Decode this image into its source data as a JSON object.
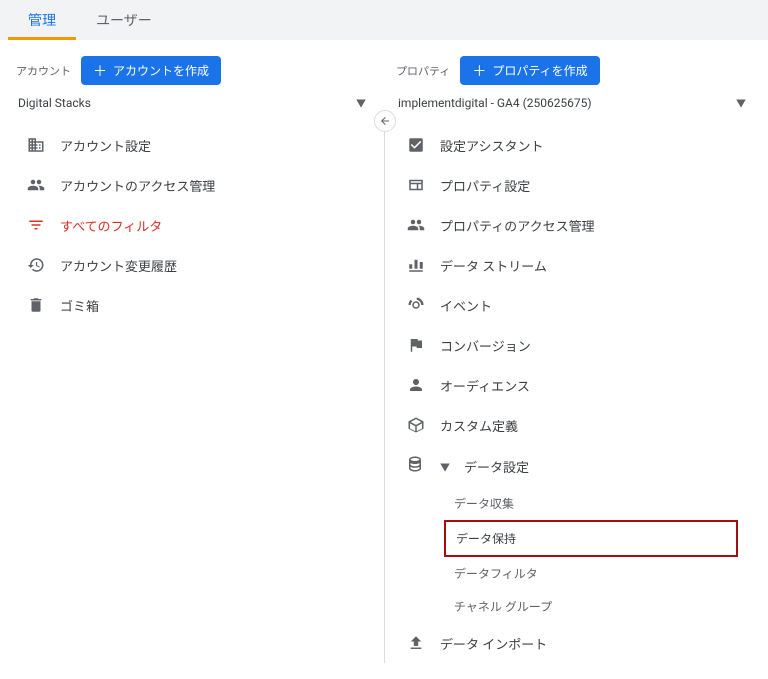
{
  "tabs": {
    "admin": "管理",
    "users": "ユーザー"
  },
  "account": {
    "label": "アカウント",
    "create_button": "アカウントを作成",
    "selected": "Digital Stacks",
    "menu": {
      "settings": "アカウント設定",
      "access": "アカウントのアクセス管理",
      "filters": "すべてのフィルタ",
      "history": "アカウント変更履歴",
      "trash": "ゴミ箱"
    }
  },
  "property": {
    "label": "プロパティ",
    "create_button": "プロパティを作成",
    "selected": "implementdigital - GA4 (250625675)",
    "menu": {
      "setup_assistant": "設定アシスタント",
      "property_settings": "プロパティ設定",
      "access": "プロパティのアクセス管理",
      "data_streams": "データ ストリーム",
      "events": "イベント",
      "conversions": "コンバージョン",
      "audiences": "オーディエンス",
      "custom_definitions": "カスタム定義",
      "data_settings": "データ設定",
      "data_import": "データ インポート"
    },
    "data_settings_sub": {
      "collection": "データ収集",
      "retention": "データ保持",
      "filters": "データフィルタ",
      "channel_groups": "チャネル グループ"
    }
  }
}
